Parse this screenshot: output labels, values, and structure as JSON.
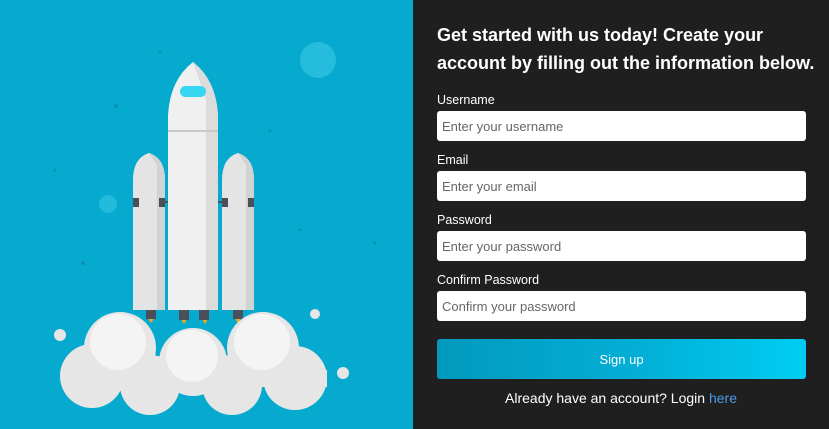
{
  "form": {
    "heading": "Get started with us today! Create your account by filling out the information below.",
    "fields": {
      "username": {
        "label": "Username",
        "placeholder": "Enter your username"
      },
      "email": {
        "label": "Email",
        "placeholder": "Enter your email"
      },
      "password": {
        "label": "Password",
        "placeholder": "Enter your password"
      },
      "confirm_password": {
        "label": "Confirm Password",
        "placeholder": "Confirm your password"
      }
    },
    "submit_label": "Sign up",
    "login_prompt": "Already have an account? Login",
    "login_link": "here"
  },
  "illustration": {
    "name": "rocket-launch-illustration",
    "colors": {
      "background": "#07AACF",
      "rocket_body": "#F0F0F0",
      "window": "#37D6F2",
      "flame": "#F5A623",
      "cloud": "#E6E6E6"
    }
  },
  "colors": {
    "panel_bg": "#1F1F1F",
    "button_gradient_start": "#0399BE",
    "button_gradient_end": "#00CDF2",
    "link": "#4C9BEA"
  }
}
